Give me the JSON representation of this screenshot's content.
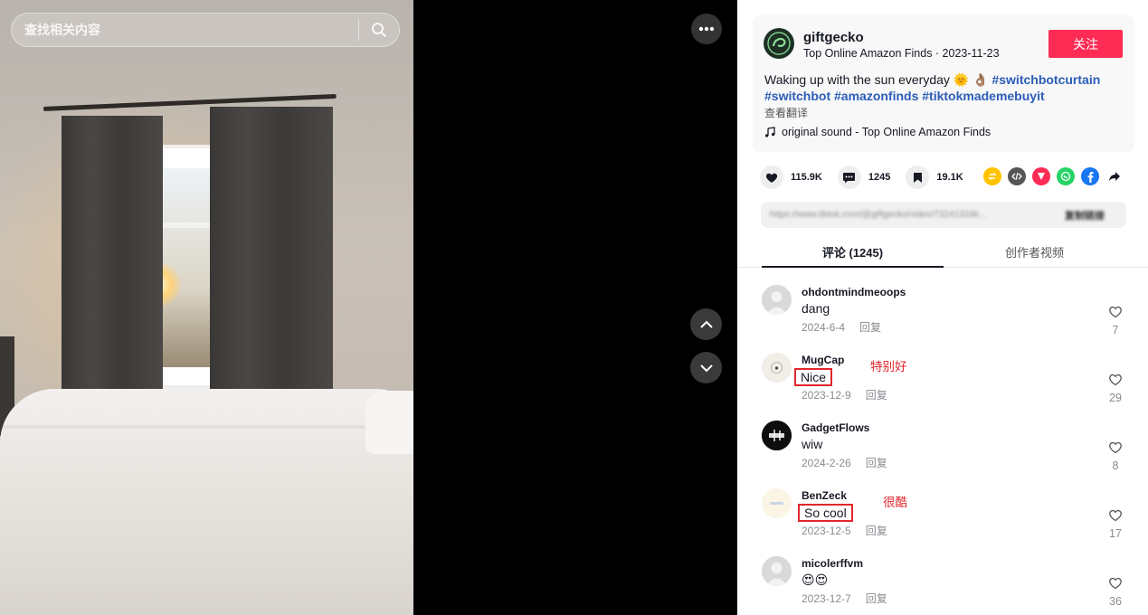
{
  "search": {
    "placeholder": "查找相关内容"
  },
  "author": {
    "name": "giftgecko",
    "subtitle": "Top  Online  Amazon  Finds · 2023-11-23",
    "follow_label": "关注"
  },
  "description": {
    "text": "Waking up with the sun everyday 🌞 👌🏽",
    "hashtags_line1": "#switchbotcurtain",
    "hashtags_line2": "#switchbot #amazonfinds #tiktokmademebuyit"
  },
  "translate_label": "查看翻译",
  "music": {
    "label": "original sound - Top  Online  Amazon  Finds"
  },
  "stats": {
    "likes": "115.9K",
    "comments": "1245",
    "saves": "19.1K"
  },
  "share_icons": [
    "repost-icon",
    "embed-icon",
    "send-icon",
    "whatsapp-icon",
    "facebook-icon",
    "share-arrow-icon"
  ],
  "link_bar": {
    "url": "https://www.tiktok.com/@giftgecko/video/73241324k...",
    "copy_label": "复制链接"
  },
  "tabs": [
    {
      "label": "评论 (1245)",
      "active": true
    },
    {
      "label": "创作者视频",
      "active": false
    }
  ],
  "comments": [
    {
      "user": "ohdontmindmeoops",
      "text": "dang",
      "date": "2024-6-4",
      "reply": "回复",
      "likes": "7",
      "note": ""
    },
    {
      "user": "MugCap",
      "text": "Nice",
      "date": "2023-12-9",
      "reply": "回复",
      "likes": "29",
      "note": "特别好"
    },
    {
      "user": "GadgetFlows",
      "text": "wiw",
      "date": "2024-2-26",
      "reply": "回复",
      "likes": "8",
      "note": ""
    },
    {
      "user": "BenZeck",
      "text": "So cool",
      "date": "2023-12-5",
      "reply": "回复",
      "likes": "17",
      "note": "很酷"
    },
    {
      "user": "micolerffvm",
      "text": "😍😍",
      "date": "2023-12-7",
      "reply": "回复",
      "likes": "36",
      "note": ""
    }
  ],
  "colors": {
    "follow": "#fe2c55",
    "hashtag": "#2b5db9",
    "annotation": "#e1262c"
  }
}
